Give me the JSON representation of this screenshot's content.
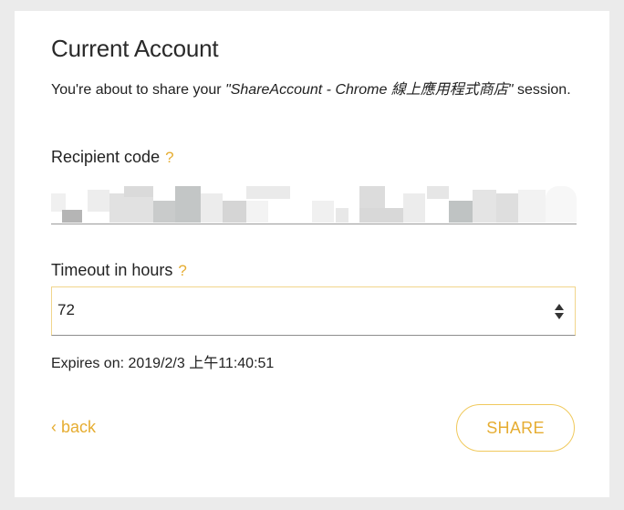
{
  "header": {
    "title": "Current Account"
  },
  "description": {
    "prefix": "You're about to share your ",
    "quoted": "\"ShareAccount - Chrome 線上應用程式商店\"",
    "suffix": " session."
  },
  "recipient": {
    "label": "Recipient code",
    "help": "?",
    "value_state": "blurred"
  },
  "timeout": {
    "label": "Timeout in hours",
    "help": "?",
    "value": "72"
  },
  "expires": {
    "text": "Expires on: 2019/2/3 上午11:40:51"
  },
  "actions": {
    "back_label": "‹ back",
    "share_label": "SHARE"
  },
  "colors": {
    "accent": "#e6ad32",
    "accent_border": "#f0c95c",
    "text": "#222222",
    "background": "#ffffff",
    "page_background": "#ebebeb"
  },
  "icons": {
    "help": "question-mark-icon",
    "spinner": "number-spinner-icon",
    "back": "chevron-left-icon"
  }
}
